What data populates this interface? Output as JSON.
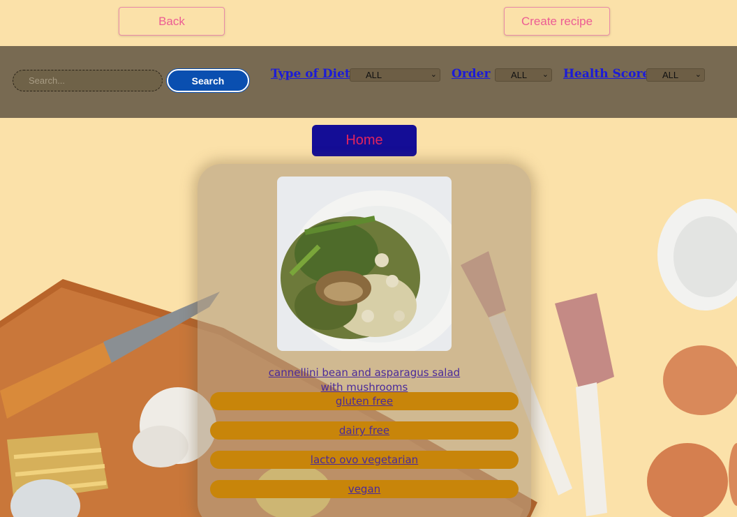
{
  "top_nav": {
    "back_label": "Back",
    "create_label": "Create recipe"
  },
  "filters": {
    "search_placeholder": "Search...",
    "search_button": "Search",
    "diet_label": "Type of Diet",
    "diet_value": "ALL",
    "order_label": "Order",
    "order_value": "ALL",
    "health_label": "Health Score",
    "health_value": "ALL"
  },
  "home_label": "Home",
  "recipe": {
    "title": "cannellini bean and asparagus salad with mushrooms",
    "diets": [
      "gluten free",
      "dairy free",
      "lacto ovo vegetarian",
      "vegan"
    ]
  },
  "colors": {
    "page_bg": "#fbe1a9",
    "filter_bar": "#786a52",
    "search_button": "#0a4fb0",
    "home_button": "#140d96",
    "home_text": "#e0245e",
    "diet_pill": "#c8850a",
    "link_text": "#4a2a9a",
    "filter_label": "#1b1bd8"
  }
}
